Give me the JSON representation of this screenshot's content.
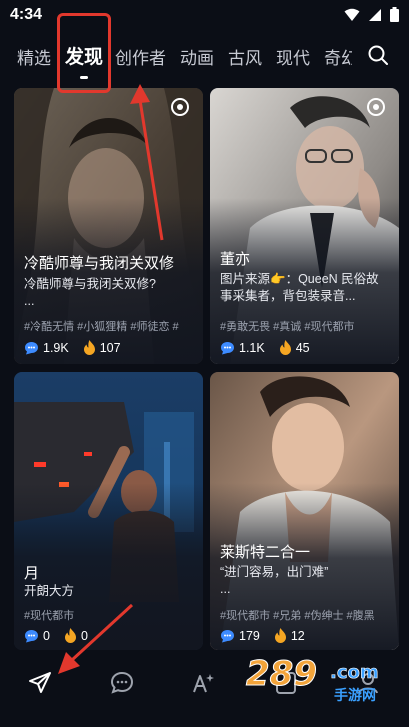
{
  "status_bar": {
    "time": "4:34"
  },
  "tabs": [
    {
      "label": "精选"
    },
    {
      "label": "发现",
      "active": true
    },
    {
      "label": "创作者"
    },
    {
      "label": "动画"
    },
    {
      "label": "古风"
    },
    {
      "label": "现代"
    },
    {
      "label": "奇幻"
    }
  ],
  "icons": {
    "search": "search-icon",
    "wifi": "wifi-icon",
    "signal": "signal-icon",
    "battery": "battery-icon",
    "chat_count": "comment-bubble-icon",
    "likes": "fire-icon"
  },
  "cards": [
    {
      "title": "冷酷师尊与我闭关双修",
      "desc": "冷酷师尊与我闭关双修?",
      "desc_more": "...",
      "tags": "#冷酷无情 #小狐狸精 #师徒恋 #",
      "chats": "1.9K",
      "likes": "107"
    },
    {
      "title": "董亦",
      "desc": "图片来源👉：QueeN 民俗故事采集者，背包装录音...",
      "desc_more": "",
      "tags": "#勇敢无畏 #真诚 #现代都市",
      "chats": "1.1K",
      "likes": "45"
    },
    {
      "title": "月",
      "desc": "开朗大方",
      "desc_more": "",
      "tags": "#现代都市",
      "chats": "0",
      "likes": "0"
    },
    {
      "title": "莱斯特二合一",
      "desc": "“进门容易，出门难”",
      "desc_more": "...",
      "tags": "#现代都市 #兄弟 #伪绅士 #腹黑",
      "chats": "179",
      "likes": "12"
    }
  ],
  "bottom_nav": [
    {
      "icon": "paper-plane-icon"
    },
    {
      "icon": "chat-bubble-icon"
    },
    {
      "icon": "ai-sparkle-icon"
    },
    {
      "icon": "contact-icon"
    },
    {
      "icon": "profile-icon"
    }
  ],
  "watermark": {
    "logo": "289",
    "suffix": ".com",
    "subtitle": "手游网"
  },
  "colors": {
    "background": "#0b0e16",
    "card": "#202532",
    "annotation_red": "#e2382d",
    "fire": "#f5a623",
    "chat_blue": "#3d8bff"
  }
}
